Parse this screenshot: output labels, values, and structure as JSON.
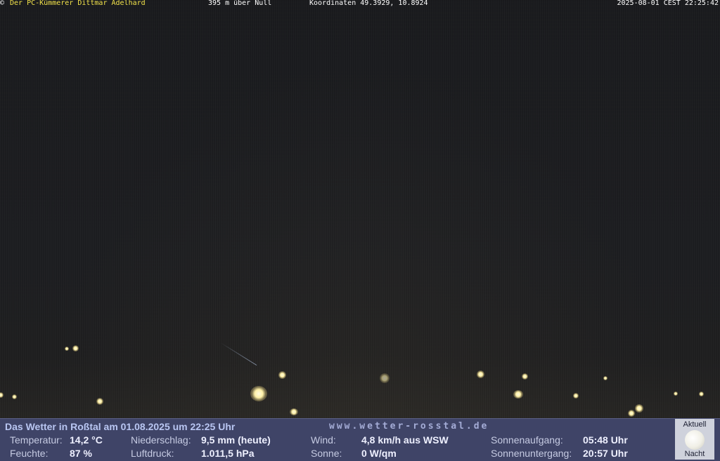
{
  "overlay": {
    "copyright_symbol": "©",
    "owner": "Der PC-Kümmerer Dittmar Adelhard",
    "altitude": "395 m über Null",
    "coordinates": "Koordinaten 49.3929, 10.8924",
    "timestamp": "2025-08-01 CEST 22:25:42"
  },
  "weather": {
    "headline": "Das Wetter in Roßtal am 01.08.2025 um 22:25 Uhr",
    "website": "www.wetter-rosstal.de",
    "temperature_label": "Temperatur:",
    "temperature_value": "14,2 °C",
    "humidity_label": "Feuchte:",
    "humidity_value": "87 %",
    "precip_label": "Niederschlag:",
    "precip_value": "9,5 mm (heute)",
    "pressure_label": "Luftdruck:",
    "pressure_value": "1.011,5 hPa",
    "wind_label": "Wind:",
    "wind_value": "4,8 km/h aus WSW",
    "sun_label": "Sonne:",
    "sun_value": "0 W/qm",
    "sunrise_label": "Sonnenaufgang:",
    "sunrise_value": "05:48 Uhr",
    "sunset_label": "Sonnenuntergang:",
    "sunset_value": "20:57 Uhr"
  },
  "moon": {
    "label_top": "Aktuell",
    "label_bottom": "Nacht",
    "icon": "moon-icon"
  }
}
